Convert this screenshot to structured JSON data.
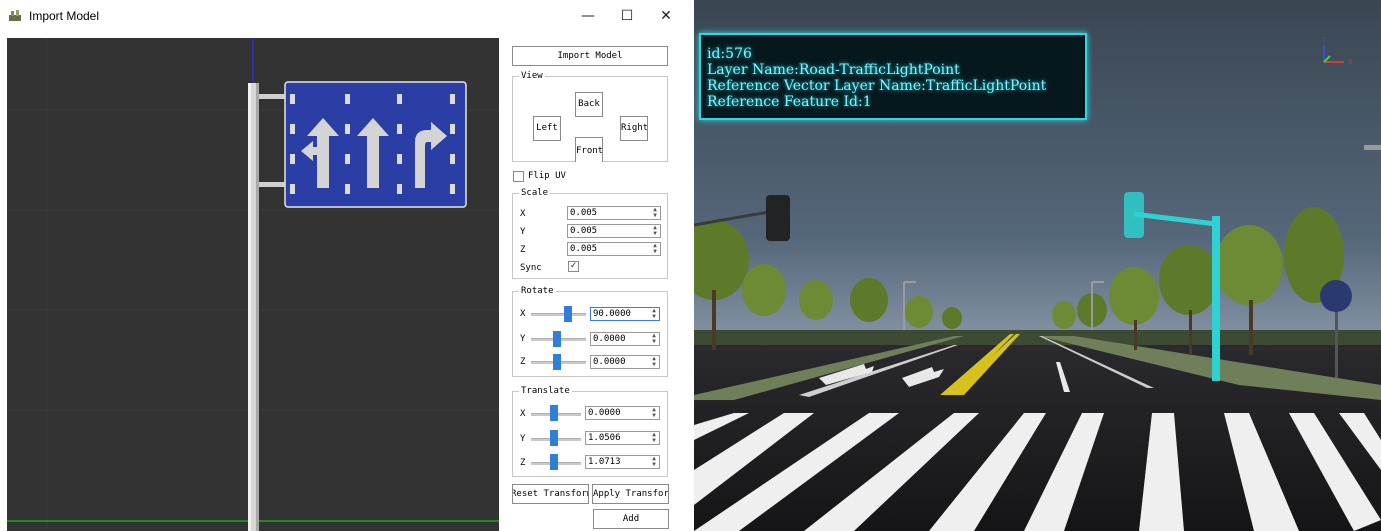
{
  "window": {
    "title": "Import Model",
    "minimize_glyph": "—",
    "maximize_glyph": "☐",
    "close_glyph": "✕"
  },
  "panel": {
    "import_button": "Import Model",
    "view": {
      "title": "View",
      "back": "Back",
      "left": "Left",
      "right": "Right",
      "front": "Front"
    },
    "flip_uv": {
      "label": "Flip UV",
      "checked": false
    },
    "scale": {
      "title": "Scale",
      "x_label": "X",
      "x_value": "0.005",
      "y_label": "Y",
      "y_value": "0.005",
      "z_label": "Z",
      "z_value": "0.005",
      "sync_label": "Sync",
      "sync_checked": true
    },
    "rotate": {
      "title": "Rotate",
      "x_label": "X",
      "x_value": "90.0000",
      "y_label": "Y",
      "y_value": "0.0000",
      "z_label": "Z",
      "z_value": "0.0000"
    },
    "translate": {
      "title": "Translate",
      "x_label": "X",
      "x_value": "0.0000",
      "y_label": "Y",
      "y_value": "1.0506",
      "z_label": "Z",
      "z_value": "1.0713"
    },
    "reset_button": "Reset Transform",
    "apply_button": "Apply Transform",
    "add_button": "Add"
  },
  "scene": {
    "info": {
      "line1": "id:576",
      "line2": "Layer Name:Road-TrafficLightPoint",
      "line3": "Reference Vector Layer Name:TrafficLightPoint",
      "line4": "Reference Feature Id:1"
    },
    "gizmo": {
      "z": "Z",
      "x": "X"
    }
  },
  "colors": {
    "sign_blue": "#2b3ea6",
    "viewport_bg": "#333333",
    "accent_cyan": "#2ad9e6",
    "slider_blue": "#2f7fd9"
  }
}
